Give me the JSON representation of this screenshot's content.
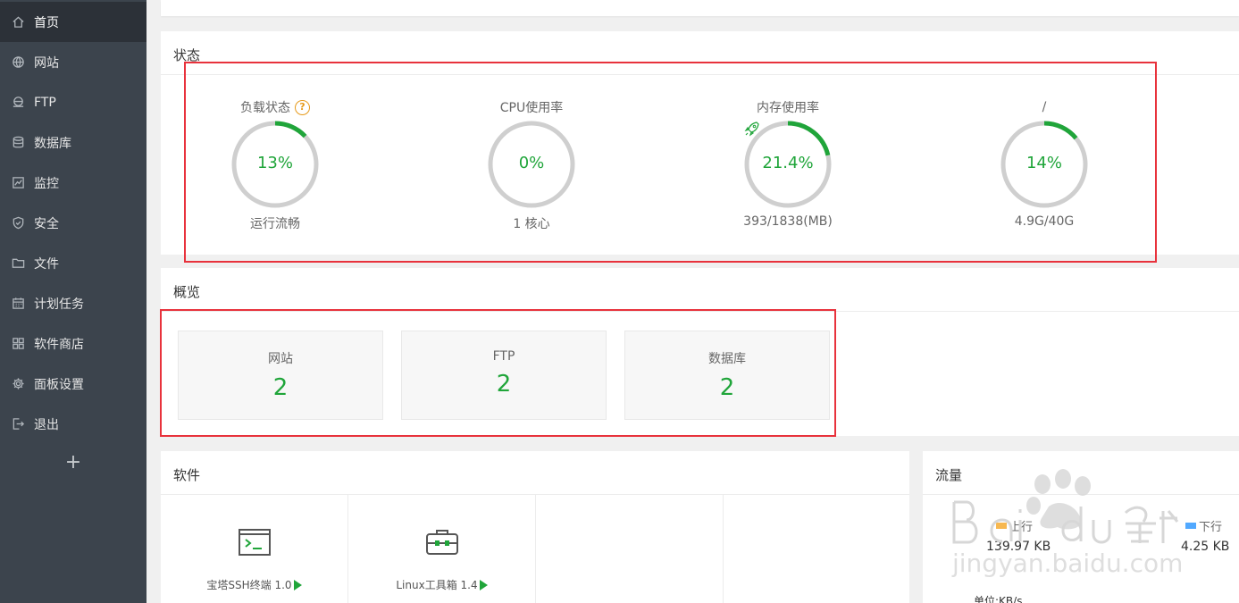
{
  "sidebar": {
    "items": [
      {
        "label": "首页",
        "icon": "home-icon",
        "active": true
      },
      {
        "label": "网站",
        "icon": "globe-icon"
      },
      {
        "label": "FTP",
        "icon": "ftp-icon"
      },
      {
        "label": "数据库",
        "icon": "database-icon"
      },
      {
        "label": "监控",
        "icon": "monitor-icon"
      },
      {
        "label": "安全",
        "icon": "shield-icon"
      },
      {
        "label": "文件",
        "icon": "folder-icon"
      },
      {
        "label": "计划任务",
        "icon": "calendar-icon"
      },
      {
        "label": "软件商店",
        "icon": "apps-icon"
      },
      {
        "label": "面板设置",
        "icon": "gear-icon"
      },
      {
        "label": "退出",
        "icon": "logout-icon"
      }
    ],
    "add_label": "+"
  },
  "status": {
    "title": "状态",
    "gauges": [
      {
        "title": "负载状态",
        "help": "?",
        "value": "13%",
        "percent": 13,
        "sub": "运行流畅"
      },
      {
        "title": "CPU使用率",
        "value": "0%",
        "percent": 0,
        "sub": "1 核心"
      },
      {
        "title": "内存使用率",
        "value": "21.4%",
        "percent": 21.4,
        "sub": "393/1838(MB)"
      },
      {
        "title": "/",
        "value": "14%",
        "percent": 14,
        "sub": "4.9G/40G"
      }
    ]
  },
  "overview": {
    "title": "概览",
    "boxes": [
      {
        "label": "网站",
        "value": "2"
      },
      {
        "label": "FTP",
        "value": "2"
      },
      {
        "label": "数据库",
        "value": "2"
      }
    ]
  },
  "software": {
    "title": "软件",
    "items": [
      {
        "label": "宝塔SSH终端 1.0",
        "icon": "terminal-icon"
      },
      {
        "label": "Linux工具箱 1.4",
        "icon": "toolbox-icon"
      }
    ]
  },
  "traffic": {
    "title": "流量",
    "up_label": "上行",
    "down_label": "下行",
    "up_value": "139.97 KB",
    "down_value": "4.25 KB",
    "unit": "单位:KB/s",
    "up_color": "#f7b851",
    "down_color": "#52a9ff"
  },
  "colors": {
    "accent": "#20a53a",
    "sidebar_bg": "#3c444d",
    "sidebar_active": "#2c3138",
    "highlight": "#e8323c"
  }
}
